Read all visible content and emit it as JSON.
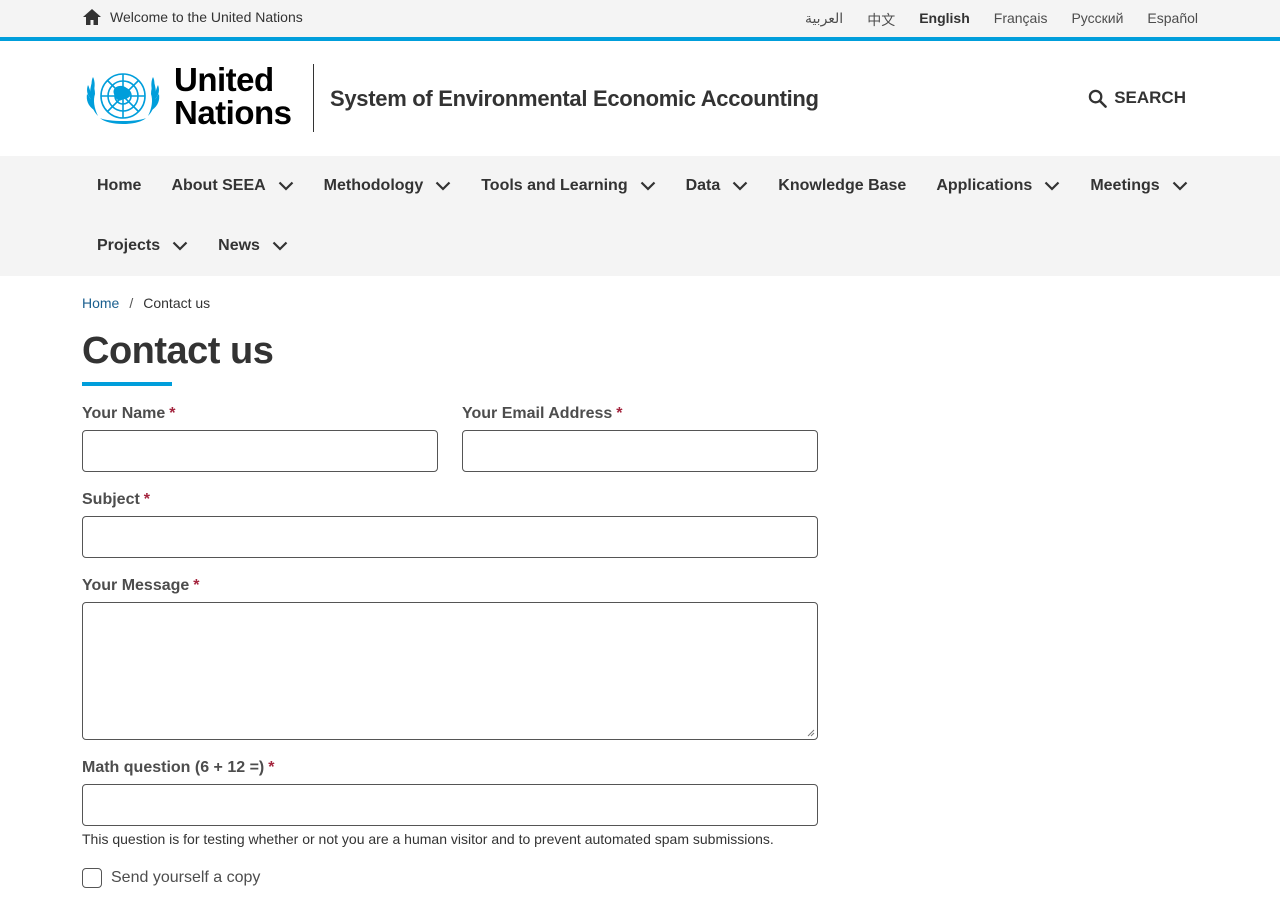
{
  "topbar": {
    "welcome_text": "Welcome to the United Nations",
    "home_icon": "home-icon",
    "languages": [
      "العربية",
      "中文",
      "English",
      "Français",
      "Русский",
      "Español"
    ],
    "active_language": "English"
  },
  "header": {
    "logo_icon": "un-emblem-icon",
    "org_line1": "United",
    "org_line2": "Nations",
    "site_name": "System of Environmental Economic Accounting",
    "search_label": "SEARCH",
    "search_icon": "search-icon"
  },
  "nav": {
    "row1": [
      {
        "label": "Home",
        "dropdown": false
      },
      {
        "label": "About SEEA",
        "dropdown": true
      },
      {
        "label": "Methodology",
        "dropdown": true
      },
      {
        "label": "Tools and Learning",
        "dropdown": true
      },
      {
        "label": "Data",
        "dropdown": true
      },
      {
        "label": "Knowledge Base",
        "dropdown": false
      },
      {
        "label": "Applications",
        "dropdown": true
      },
      {
        "label": "Meetings",
        "dropdown": true
      }
    ],
    "row2": [
      {
        "label": "Projects",
        "dropdown": true
      },
      {
        "label": "News",
        "dropdown": true
      }
    ]
  },
  "breadcrumb": {
    "home": "Home",
    "separator": "/",
    "current": "Contact us"
  },
  "page": {
    "title": "Contact us"
  },
  "form": {
    "name_label": "Your Name",
    "name_value": "",
    "email_label": "Your Email Address",
    "email_value": "",
    "subject_label": "Subject",
    "subject_value": "",
    "message_label": "Your Message",
    "message_value": "",
    "math_label": "Math question (6 + 12 =)",
    "math_value": "",
    "required_mark": "*",
    "math_help": "This question is for testing whether or not you are a human visitor and to prevent automated spam submissions.",
    "copy_label": "Send yourself a copy",
    "copy_checked": false
  },
  "colors": {
    "accent": "#009edb",
    "required": "#a4253e",
    "link": "#1a5f8f",
    "nav_bg": "#f4f4f4"
  }
}
